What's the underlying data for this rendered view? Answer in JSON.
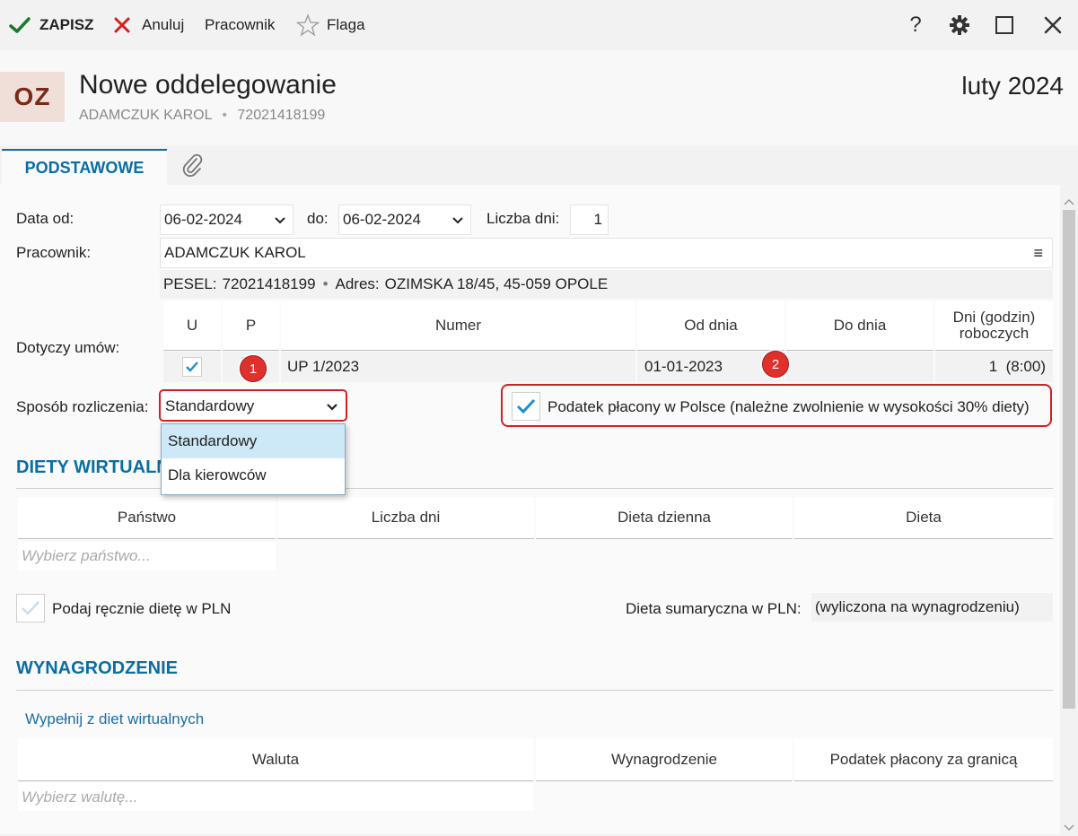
{
  "toolbar": {
    "save_label": "ZAPISZ",
    "cancel_label": "Anuluj",
    "employee_label": "Pracownik",
    "flag_label": "Flaga",
    "help_glyph": "?"
  },
  "header": {
    "avatar_initials": "OZ",
    "title": "Nowe oddelegowanie",
    "employee_name": "ADAMCZUK KAROL",
    "separator": "•",
    "pesel": "72021418199",
    "period": "luty 2024"
  },
  "tabs": {
    "basic_label": "PODSTAWOWE"
  },
  "form": {
    "date_from_label": "Data od:",
    "date_from_value": "06-02-2024",
    "date_to_label": "do:",
    "date_to_value": "06-02-2024",
    "days_label": "Liczba dni:",
    "days_value": "1",
    "employee_label": "Pracownik:",
    "employee_value": "ADAMCZUK KAROL",
    "employee_menu_glyph": "≡",
    "pesel_label": "PESEL:",
    "pesel_value": "72021418199",
    "address_sep": "•",
    "address_label": "Adres:",
    "address_value": "OZIMSKA 18/45, 45-059 OPOLE",
    "contracts_label": "Dotyczy umów:",
    "settlement_label": "Sposób rozliczenia:",
    "settlement_value": "Standardowy",
    "tax_poland_label": "Podatek płacony w Polsce (należne zwolnienie w wysokości 30% diety)"
  },
  "contracts_table": {
    "headers": [
      "U",
      "P",
      "Numer",
      "Od dnia",
      "Do dnia",
      "Dni (godzin)\nroboczych"
    ],
    "rows": [
      {
        "u_checked": true,
        "p_checked": false,
        "numer": "UP 1/2023",
        "od_dnia": "01-01-2023",
        "do_dnia": "",
        "dni": "1  (8:00)"
      }
    ]
  },
  "dropdown": {
    "options": [
      "Standardowy",
      "Dla kierowców"
    ],
    "selected_index": 0
  },
  "badges": [
    "1",
    "2"
  ],
  "diets": {
    "section_title": "DIETY WIRTUALNE",
    "headers": [
      "Państwo",
      "Liczba dni",
      "Dieta dzienna",
      "Dieta"
    ],
    "country_placeholder": "Wybierz państwo...",
    "manual_label": "Podaj ręcznie dietę w PLN",
    "summary_label": "Dieta sumaryczna w PLN:",
    "summary_value": "(wyliczona na wynagrodzeniu)"
  },
  "salary": {
    "section_title": "WYNAGRODZENIE",
    "fill_link": "Wypełnij z diet wirtualnych",
    "headers": [
      "Waluta",
      "Wynagrodzenie",
      "Podatek płacony za granicą"
    ],
    "currency_placeholder": "Wybierz walutę..."
  },
  "colors": {
    "accent": "#0a6ea3",
    "save_green": "#1a7a2a",
    "cancel_red": "#d32020",
    "highlight_red": "#d32020",
    "check_blue": "#1a8fd0"
  }
}
